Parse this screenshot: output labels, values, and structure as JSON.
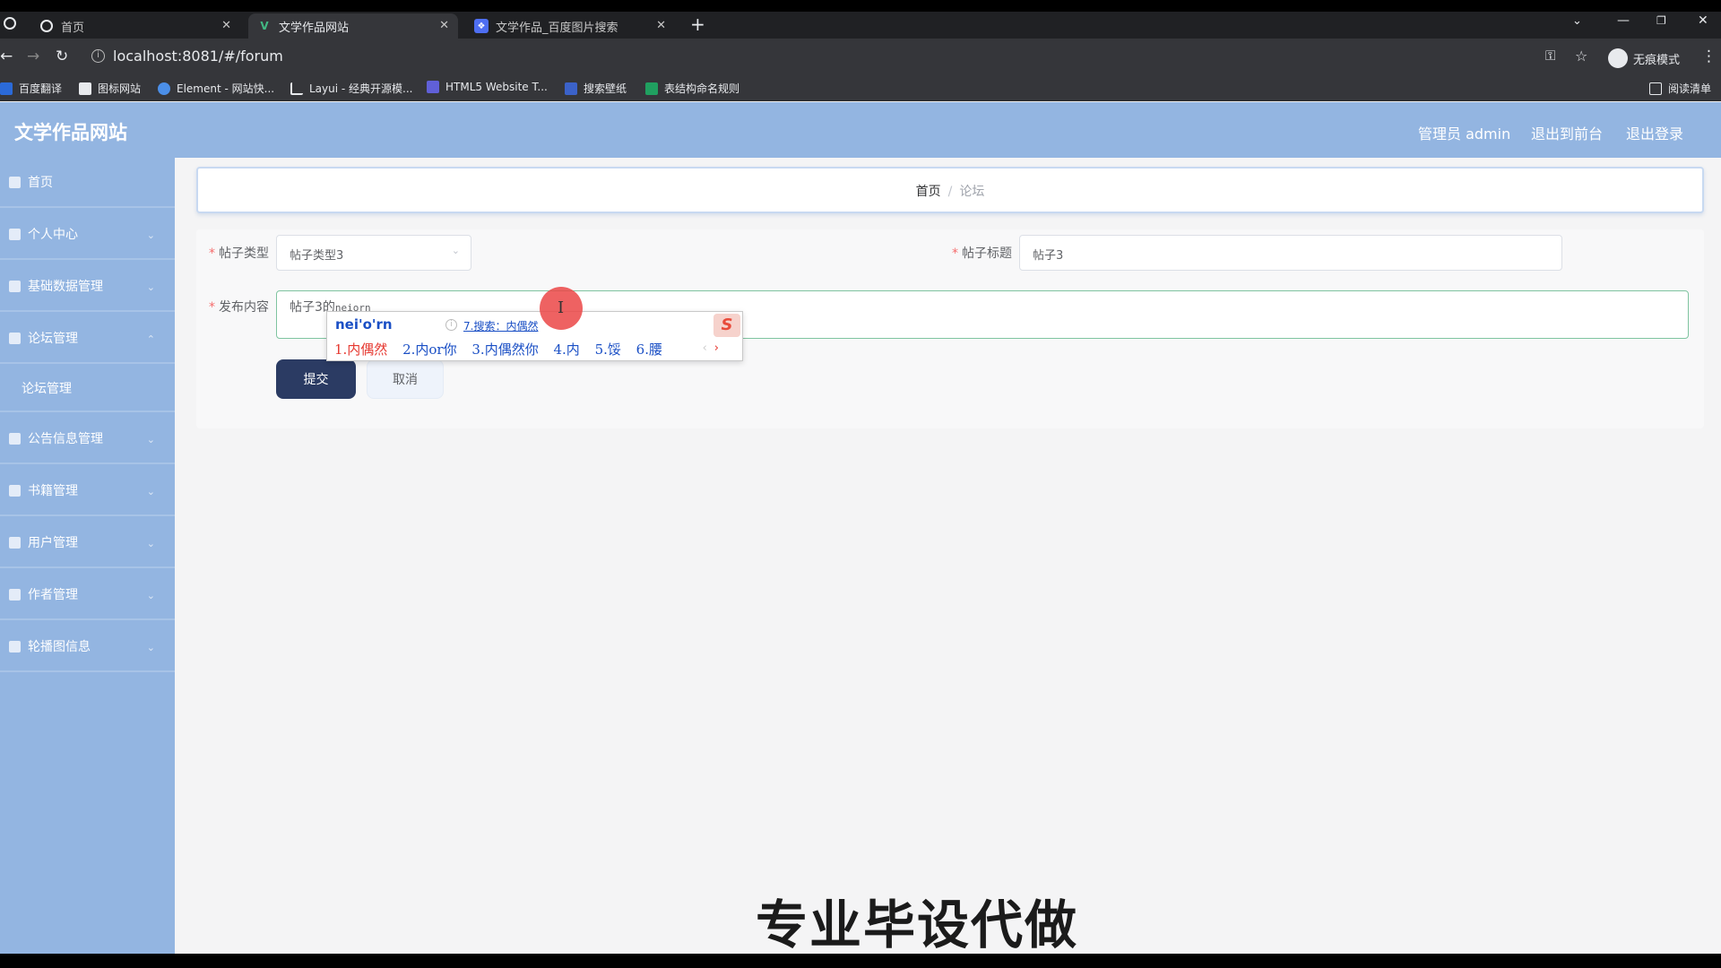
{
  "browser": {
    "tabs": [
      {
        "title": "首页",
        "active": false
      },
      {
        "title": "文学作品网站",
        "active": true
      },
      {
        "title": "文学作品_百度图片搜索",
        "active": false
      }
    ],
    "new_tab": "+",
    "url": "localhost:8081/#/forum",
    "incognito_label": "无痕模式",
    "reading_list": "阅读清单",
    "bookmarks": [
      {
        "label": "百度翻译",
        "color": "#2b6ad8"
      },
      {
        "label": "图标网站",
        "color": "#e8eaed"
      },
      {
        "label": "Element - 网站快...",
        "color": "#4b8fe8"
      },
      {
        "label": "Layui - 经典开源模...",
        "color": "#e8eaed"
      },
      {
        "label": "HTML5 Website T...",
        "color": "#6060d8"
      },
      {
        "label": "搜索壁纸",
        "color": "#3b62c9"
      },
      {
        "label": "表结构命名规则",
        "color": "#20a060"
      }
    ]
  },
  "app": {
    "title": "文学作品网站",
    "header_links": [
      "管理员 admin",
      "退出到前台",
      "退出登录"
    ],
    "accent": "#93b5e1"
  },
  "sidebar": {
    "items": [
      {
        "label": "首页",
        "icon": "home-icon",
        "has_children": false
      },
      {
        "label": "个人中心",
        "icon": "user-icon",
        "has_children": true
      },
      {
        "label": "基础数据管理",
        "icon": "gift-icon",
        "has_children": true
      },
      {
        "label": "论坛管理",
        "icon": "forum-icon",
        "has_children": true
      },
      {
        "label": "公告信息管理",
        "icon": "clock-icon",
        "has_children": true
      },
      {
        "label": "书籍管理",
        "icon": "grid-icon",
        "has_children": true
      },
      {
        "label": "用户管理",
        "icon": "list-icon",
        "has_children": true
      },
      {
        "label": "作者管理",
        "icon": "pin-icon",
        "has_children": true
      },
      {
        "label": "轮播图信息",
        "icon": "image-icon",
        "has_children": true
      }
    ],
    "submenu": {
      "label": "论坛管理"
    }
  },
  "breadcrumb": {
    "home": "首页",
    "separator": "/",
    "current": "论坛"
  },
  "form": {
    "type_label": "帖子类型",
    "type_value": "帖子类型3",
    "title_label": "帖子标题",
    "title_value": "帖子3",
    "content_label": "发布内容",
    "content_value": "帖子3的",
    "content_composition": "neiorn",
    "submit_label": "提交",
    "cancel_label": "取消"
  },
  "ime": {
    "input": "nei'o'rn",
    "search": "7.搜索：内偶然",
    "candidates": [
      "1.内偶然",
      "2.内or你",
      "3.内偶然你",
      "4.内",
      "5.馁",
      "6.腰"
    ],
    "logo": "S"
  },
  "watermark": "专业毕设代做"
}
